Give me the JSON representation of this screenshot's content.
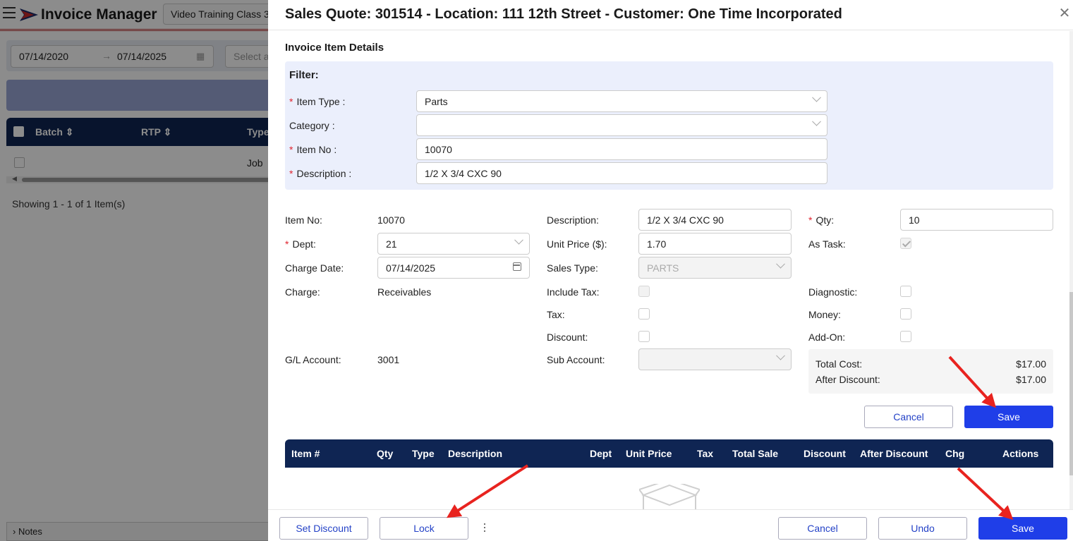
{
  "background": {
    "app_title": "Invoice Manager",
    "tab_label": "Video Training Class 3",
    "date_from": "07/14/2020",
    "date_to": "07/14/2025",
    "select_placeholder": "Select a",
    "columns": [
      "Batch",
      "RTP",
      "Type"
    ],
    "row_type": "Job",
    "showing": "Showing 1 - 1 of 1 Item(s)",
    "notes_label": "Notes"
  },
  "modal": {
    "title": "Sales Quote: 301514 - Location: 111 12th Street - Customer: One Time Incorporated",
    "section_title": "Invoice Item Details",
    "filter": {
      "heading": "Filter:",
      "item_type_label": "Item Type",
      "item_type_value": "Parts",
      "category_label": "Category",
      "category_value": "",
      "item_no_label": "Item No",
      "item_no_value": "10070",
      "description_label": "Description",
      "description_value": "1/2 X 3/4 CXC 90"
    },
    "details": {
      "item_no_label": "Item No:",
      "item_no_value": "10070",
      "dept_label": "Dept:",
      "dept_value": "21",
      "charge_date_label": "Charge Date:",
      "charge_date_value": "07/14/2025",
      "charge_label": "Charge:",
      "charge_value": "Receivables",
      "gl_account_label": "G/L Account:",
      "gl_account_value": "3001",
      "description_label": "Description:",
      "description_value": "1/2 X 3/4 CXC 90",
      "unit_price_label": "Unit Price ($):",
      "unit_price_value": "1.70",
      "sales_type_label": "Sales Type:",
      "sales_type_value": "PARTS",
      "include_tax_label": "Include Tax:",
      "tax_label": "Tax:",
      "discount_label": "Discount:",
      "sub_account_label": "Sub Account:",
      "qty_label": "Qty:",
      "qty_value": "10",
      "as_task_label": "As Task:",
      "diagnostic_label": "Diagnostic:",
      "money_label": "Money:",
      "add_on_label": "Add-On:"
    },
    "totals": {
      "total_cost_label": "Total Cost:",
      "total_cost_value": "$17.00",
      "after_discount_label": "After Discount:",
      "after_discount_value": "$17.00"
    },
    "item_buttons": {
      "cancel": "Cancel",
      "save": "Save"
    },
    "grid_columns": [
      "Item #",
      "Qty",
      "Type",
      "Description",
      "Dept",
      "Unit Price",
      "Tax",
      "Total Sale",
      "Discount",
      "After Discount",
      "Chg",
      "Actions"
    ],
    "footer": {
      "set_discount": "Set Discount",
      "lock": "Lock",
      "cancel": "Cancel",
      "undo": "Undo",
      "save": "Save"
    }
  },
  "colors": {
    "header_navy": "#0f2553",
    "primary_blue": "#1f3ee8",
    "required_red": "#e0242f",
    "annotation_arrow": "#e8231f"
  }
}
